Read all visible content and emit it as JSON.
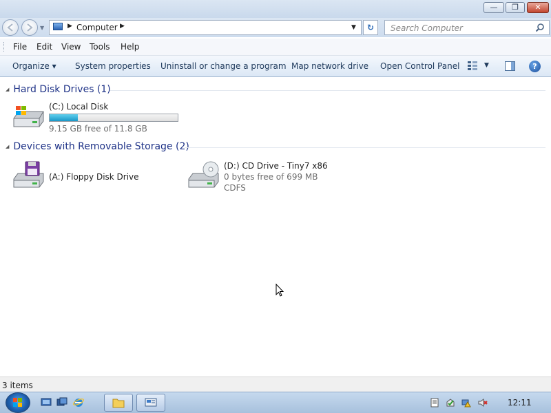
{
  "window": {
    "controls": {
      "minimize": "—",
      "maximize": "❐",
      "close": "✕"
    }
  },
  "address": {
    "path": "Computer",
    "search_placeholder": "Search Computer",
    "refresh_glyph": "↻"
  },
  "menu": [
    "File",
    "Edit",
    "View",
    "Tools",
    "Help"
  ],
  "commands": {
    "organize": "Organize ▾",
    "system_properties": "System properties",
    "uninstall": "Uninstall or change a program",
    "map_drive": "Map network drive",
    "control_panel": "Open Control Panel",
    "help_glyph": "?"
  },
  "groups": {
    "hdd": {
      "title": "Hard Disk Drives (1)",
      "drives": [
        {
          "name": "(C:) Local Disk",
          "free": "9.15 GB free of 11.8 GB",
          "used_fraction": 0.22,
          "icon": "hard-drive-icon"
        }
      ]
    },
    "removable": {
      "title": "Devices with Removable Storage (2)",
      "drives": [
        {
          "name": "(A:) Floppy Disk Drive",
          "icon": "floppy-drive-icon"
        },
        {
          "name": "(D:) CD Drive - Tiny7 x86",
          "free": "0 bytes free of 699 MB",
          "fs": "CDFS",
          "icon": "cd-drive-icon"
        }
      ]
    }
  },
  "status": {
    "items": "3 items"
  },
  "taskbar": {
    "clock": "12:11"
  },
  "colors": {
    "accent": "#1e3287",
    "bar_fill": "#1a97c7"
  }
}
